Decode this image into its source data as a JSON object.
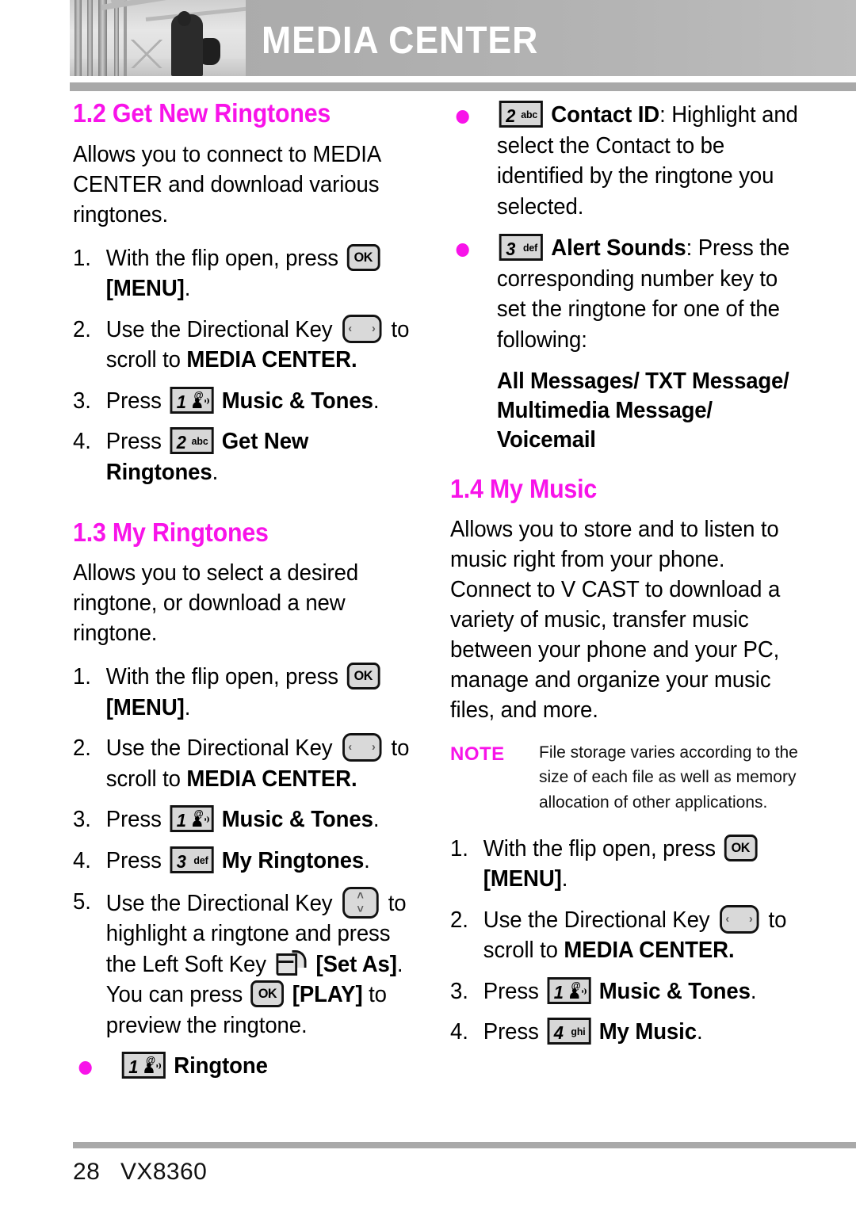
{
  "header": {
    "title": "MEDIA CENTER",
    "photo_alt": "grayscale-photo-person-walking"
  },
  "colors": {
    "accent": "#F813E9",
    "header_band": "#ADADAD",
    "rule": "#A9A9A9",
    "key_fill": "#D7D7D7"
  },
  "left_column": {
    "section_1_2": {
      "heading": "1.2 Get New Ringtones",
      "intro": "Allows you to connect to MEDIA CENTER and download various ringtones.",
      "steps": [
        {
          "num": "1.",
          "pre": "With the flip open, press ",
          "key": "OK",
          "post": " [MENU]."
        },
        {
          "num": "2.",
          "pre": "Use the Directional Key ",
          "key": "dpad-horizontal",
          "post": " to scroll to MEDIA CENTER."
        },
        {
          "num": "3.",
          "pre": "Press ",
          "key": "1",
          "post": " Music & Tones."
        },
        {
          "num": "4.",
          "pre": "Press ",
          "key": "2abc",
          "post": " Get New Ringtones."
        }
      ],
      "step1_pre": "With the flip open, press",
      "step1_bold": "[MENU]",
      "step1_end": ".",
      "step2_pre": "Use the Directional Key",
      "step2_mid": "to",
      "step2_tail_pre": "scroll to ",
      "step2_tail_bold": "MEDIA CENTER.",
      "step3_pre": "Press",
      "step3_bold": "Music & Tones",
      "step3_end": ".",
      "step4_pre": "Press",
      "step4_bold": "Get New Ringtones",
      "step4_end": "."
    },
    "section_1_3": {
      "heading": "1.3 My Ringtones",
      "intro": "Allows you to select a desired ringtone, or download  a new ringtone.",
      "step1_pre": "With the flip open, press",
      "step1_bold": "[MENU]",
      "step1_end": ".",
      "step2_pre": "Use the Directional Key",
      "step2_mid": "to",
      "step2_tail_pre": "scroll to ",
      "step2_tail_bold": "MEDIA CENTER.",
      "step3_pre": "Press",
      "step3_bold": "Music & Tones",
      "step3_end": ".",
      "step4_pre": "Press",
      "step4_bold": "My Ringtones",
      "step4_end": ".",
      "step5_pre": "Use the Directional Key",
      "step5_mid": "to highlight a ringtone and press the Left Soft Key",
      "step5_bold1": "[Set As]",
      "step5_mid2": ". You can press",
      "step5_bold2": "[PLAY]",
      "step5_end": "to preview the ringtone.",
      "bullet_ringtone": "Ringtone"
    }
  },
  "right_column": {
    "bullets": [
      {
        "key": "2abc",
        "bold": "Contact ID",
        "text": ": Highlight and select the Contact to be identified by the ringtone you selected."
      },
      {
        "key": "3def",
        "bold": "Alert Sounds",
        "text": ": Press the corresponding number key to set the ringtone for one of the following:"
      }
    ],
    "bullet1_bold": "Contact ID",
    "bullet1_text": ": Highlight and select the Contact to be identified by the ringtone you selected.",
    "bullet2_bold": "Alert Sounds",
    "bullet2_text": ": Press the corresponding number key to set the ringtone for one of the following:",
    "options_line": "All Messages/ TXT Message/ Multimedia Message/ Voicemail",
    "section_1_4": {
      "heading": "1.4 My Music",
      "intro": "Allows you to store and to listen to music right from your phone. Connect to V CAST to download a variety of music, transfer music between your phone and your PC, manage and organize your music files, and more.",
      "note_label": "NOTE",
      "note_text": "File storage varies according to the size of each file as well as memory allocation of other applications.",
      "step1_pre": "With the flip open, press",
      "step1_bold": "[MENU]",
      "step1_end": ".",
      "step2_pre": "Use the Directional Key",
      "step2_mid": "to",
      "step2_tail_pre": "scroll to ",
      "step2_tail_bold": "MEDIA CENTER.",
      "step3_pre": "Press",
      "step3_bold": "Music & Tones",
      "step3_end": ".",
      "step4_pre": "Press",
      "step4_bold": "My Music",
      "step4_end": "."
    }
  },
  "keys": {
    "ok": "OK",
    "k1_sub": "@",
    "k2_digit": "2",
    "k2_sub": "abc",
    "k3_digit": "3",
    "k3_sub": "def",
    "k4_digit": "4",
    "k4_sub": "ghi",
    "k1_digit": "1",
    "arrow_left": "‹",
    "arrow_right": "›",
    "arrow_up": "˄",
    "arrow_down": "˅"
  },
  "step_numbers": {
    "n1": "1.",
    "n2": "2.",
    "n3": "3.",
    "n4": "4.",
    "n5": "5."
  },
  "footer": {
    "page": "28",
    "model": "VX8360"
  }
}
